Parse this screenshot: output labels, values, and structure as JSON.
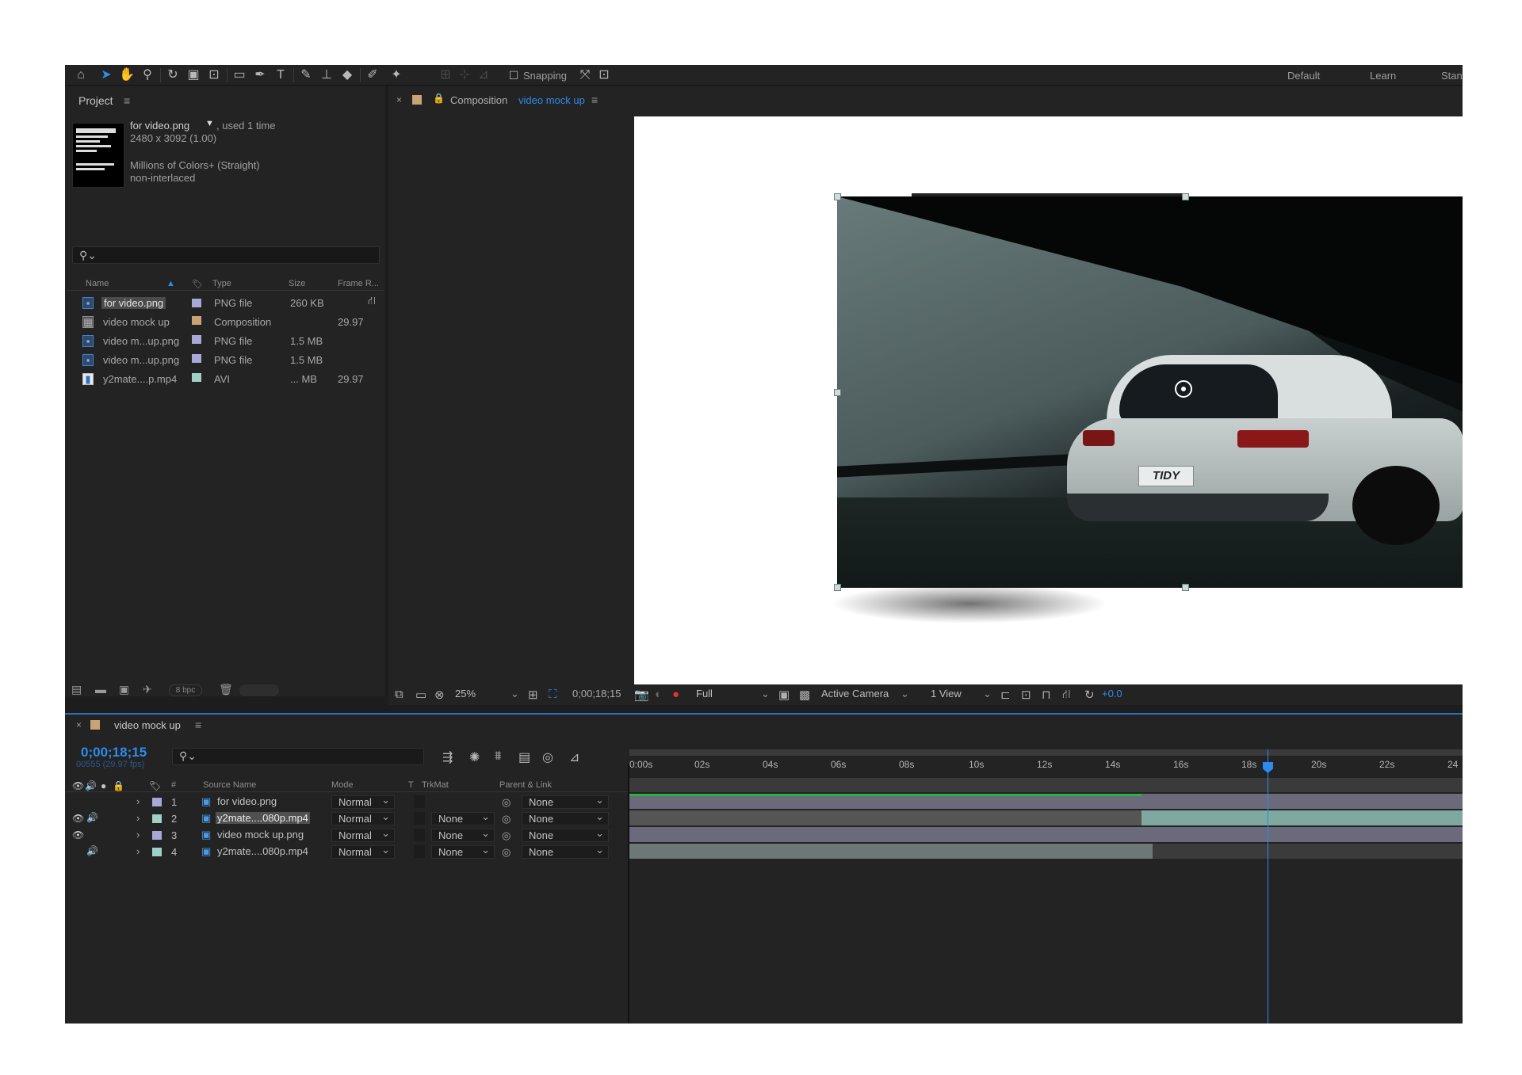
{
  "toolbar": {
    "snapping_label": "Snapping",
    "workspaces": [
      "Default",
      "Learn",
      "Stan"
    ],
    "icons": [
      "home-icon",
      "selection-icon",
      "hand-icon",
      "zoom-icon",
      "rotate-icon",
      "camera-orbit-icon",
      "pan-behind-icon",
      "rectangle-icon",
      "pen-icon",
      "text-icon",
      "brush-icon",
      "clone-stamp-icon",
      "eraser-icon",
      "roto-brush-icon",
      "puppet-pin-icon"
    ]
  },
  "project": {
    "title": "Project",
    "selected_file": "for video.png",
    "usage": ", used 1 time",
    "dimensions": "2480 x 3092 (1.00)",
    "colors": "Millions of Colors+ (Straight)",
    "interlace": "non-interlaced",
    "search_placeholder": "",
    "columns": [
      "Name",
      "Type",
      "Size",
      "Frame R..."
    ],
    "rows": [
      {
        "name": "for video.png",
        "type": "PNG file",
        "size": "260 KB",
        "fps": "",
        "label_color": "#a9a6d8",
        "icon": "png-file-icon",
        "selected": true
      },
      {
        "name": "video mock up",
        "type": "Composition",
        "size": "",
        "fps": "29.97",
        "label_color": "#c9a277",
        "icon": "composition-icon",
        "selected": false
      },
      {
        "name": "video m...up.png",
        "type": "PNG file",
        "size": "1.5 MB",
        "fps": "",
        "label_color": "#a9a6d8",
        "icon": "png-file-icon",
        "selected": false
      },
      {
        "name": "video m...up.png",
        "type": "PNG file",
        "size": "1.5 MB",
        "fps": "",
        "label_color": "#a9a6d8",
        "icon": "png-file-icon",
        "selected": false
      },
      {
        "name": "y2mate....p.mp4",
        "type": "AVI",
        "size": "... MB",
        "fps": "29.97",
        "label_color": "#9ed0c6",
        "icon": "video-file-icon",
        "selected": false
      }
    ],
    "bpc": "8 bpc"
  },
  "composition": {
    "tab_prefix": "Composition",
    "tab_name": "video mock up",
    "plate_text": "TIDY"
  },
  "viewer_bar": {
    "zoom": "25%",
    "timecode": "0;00;18;15",
    "resolution": "Full",
    "camera": "Active Camera",
    "views": "1 View",
    "exposure": "+0.0"
  },
  "timeline": {
    "tab_name": "video mock up",
    "timecode": "0;00;18;15",
    "frames_fps": "00555 (29.97 fps)",
    "col_headers": {
      "num": "#",
      "source": "Source Name",
      "mode": "Mode",
      "t": "T",
      "trkmat": "TrkMat",
      "parent": "Parent & Link"
    },
    "layers": [
      {
        "num": "1",
        "name": "for video.png",
        "mode": "Normal",
        "trkmat": "",
        "parent": "None",
        "label_color": "#a9a6d8",
        "eye": false,
        "audio": false,
        "selected": false
      },
      {
        "num": "2",
        "name": "y2mate....080p.mp4",
        "mode": "Normal",
        "trkmat": "None",
        "parent": "None",
        "label_color": "#9ed0c6",
        "eye": true,
        "audio": true,
        "selected": true
      },
      {
        "num": "3",
        "name": "video mock up.png",
        "mode": "Normal",
        "trkmat": "None",
        "parent": "None",
        "label_color": "#a9a6d8",
        "eye": true,
        "audio": false,
        "selected": false
      },
      {
        "num": "4",
        "name": "y2mate....080p.mp4",
        "mode": "Normal",
        "trkmat": "None",
        "parent": "None",
        "label_color": "#9ed0c6",
        "eye": false,
        "audio": true,
        "selected": false
      }
    ],
    "ruler_ticks": [
      "0:00s",
      "02s",
      "04s",
      "06s",
      "08s",
      "10s",
      "12s",
      "14s",
      "16s",
      "18s",
      "20s",
      "22s",
      "24"
    ],
    "current_time_seconds": 18.5
  }
}
